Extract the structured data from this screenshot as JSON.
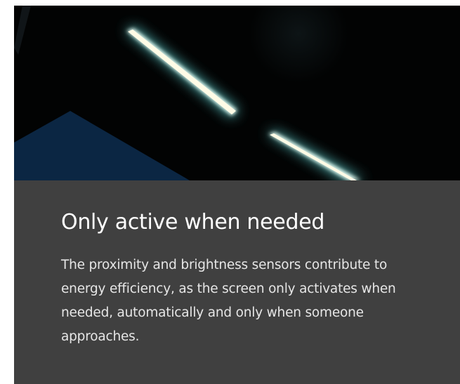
{
  "feature": {
    "title": "Only active when needed",
    "description": "The proximity and brightness sensors contribute to energy efficiency, as the screen only activates when needed, automatically and only when someone approaches."
  },
  "colors": {
    "hero_background": "#020303",
    "panel_background": "#404040",
    "light_bar": "#fffbe6",
    "light_glow": "#5fd4d4",
    "accent_blue": "#0c2a4a"
  },
  "icons": {
    "hero_image": "glowing-light-strips-image"
  }
}
